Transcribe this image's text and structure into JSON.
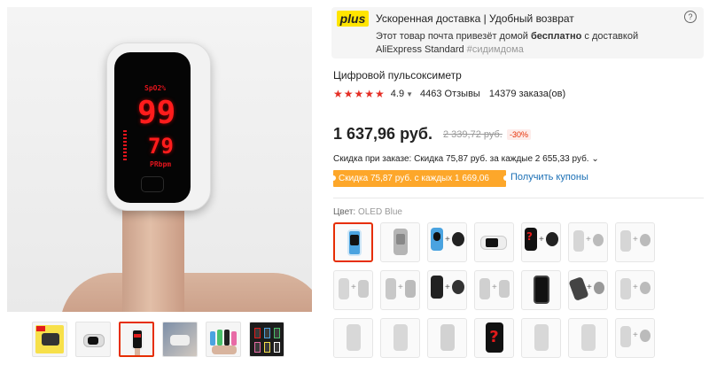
{
  "gallery": {
    "main_image": {
      "screen_labels": {
        "spo2": "SpO2%",
        "pr": "PRbpm"
      },
      "spo2_value": "99",
      "pr_value": "79"
    },
    "thumbnails": [
      "thumb-1",
      "thumb-2",
      "thumb-3",
      "thumb-4",
      "thumb-5",
      "thumb-6"
    ],
    "active_thumbnail": 3
  },
  "plus": {
    "logo": "plus",
    "title": "Ускоренная доставка | Удобный возврат",
    "text_before": "Этот товар почта привезёт домой ",
    "text_bold": "бесплатно",
    "text_after": " с доставкой AliExpress Standard ",
    "hashtag": "#сидимдома",
    "help_icon": "?"
  },
  "product": {
    "title": "Цифровой пульсоксиметр",
    "stars": "★★★★★",
    "rating": "4.9",
    "reviews": "4463 Отзывы",
    "orders": "14379 заказа(ов)",
    "price": "1 637,96 руб.",
    "old_price": "2 339,72 руб.",
    "discount": "-30%",
    "coupon_info": "Скидка при заказе: Скидка 75,87 руб. за каждые 2 655,33 руб. ⌄",
    "coupon_tag": "Скидка 75,87 руб. с каждых 1 669,06 руб.",
    "get_coupons": "Получить купоны"
  },
  "colors": {
    "label": "Цвет: ",
    "selected_name": "OLED Blue",
    "count": 21,
    "selected_index": 0
  },
  "theme": {
    "accent": "#e62e04",
    "plus_yellow": "#ffe500",
    "coupon_orange": "#fda72a",
    "link_blue": "#1a6fb5"
  }
}
